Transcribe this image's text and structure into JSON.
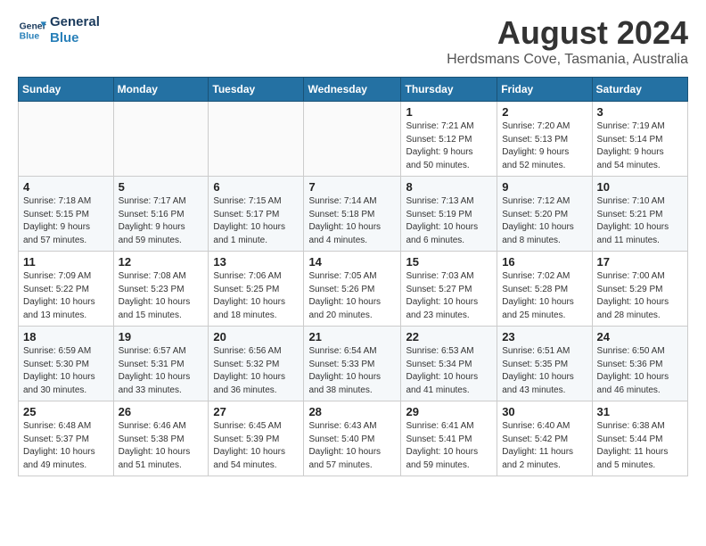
{
  "logo": {
    "line1": "General",
    "line2": "Blue"
  },
  "title": "August 2024",
  "location": "Herdsmans Cove, Tasmania, Australia",
  "headers": [
    "Sunday",
    "Monday",
    "Tuesday",
    "Wednesday",
    "Thursday",
    "Friday",
    "Saturday"
  ],
  "weeks": [
    [
      {
        "day": "",
        "info": ""
      },
      {
        "day": "",
        "info": ""
      },
      {
        "day": "",
        "info": ""
      },
      {
        "day": "",
        "info": ""
      },
      {
        "day": "1",
        "info": "Sunrise: 7:21 AM\nSunset: 5:12 PM\nDaylight: 9 hours\nand 50 minutes."
      },
      {
        "day": "2",
        "info": "Sunrise: 7:20 AM\nSunset: 5:13 PM\nDaylight: 9 hours\nand 52 minutes."
      },
      {
        "day": "3",
        "info": "Sunrise: 7:19 AM\nSunset: 5:14 PM\nDaylight: 9 hours\nand 54 minutes."
      }
    ],
    [
      {
        "day": "4",
        "info": "Sunrise: 7:18 AM\nSunset: 5:15 PM\nDaylight: 9 hours\nand 57 minutes."
      },
      {
        "day": "5",
        "info": "Sunrise: 7:17 AM\nSunset: 5:16 PM\nDaylight: 9 hours\nand 59 minutes."
      },
      {
        "day": "6",
        "info": "Sunrise: 7:15 AM\nSunset: 5:17 PM\nDaylight: 10 hours\nand 1 minute."
      },
      {
        "day": "7",
        "info": "Sunrise: 7:14 AM\nSunset: 5:18 PM\nDaylight: 10 hours\nand 4 minutes."
      },
      {
        "day": "8",
        "info": "Sunrise: 7:13 AM\nSunset: 5:19 PM\nDaylight: 10 hours\nand 6 minutes."
      },
      {
        "day": "9",
        "info": "Sunrise: 7:12 AM\nSunset: 5:20 PM\nDaylight: 10 hours\nand 8 minutes."
      },
      {
        "day": "10",
        "info": "Sunrise: 7:10 AM\nSunset: 5:21 PM\nDaylight: 10 hours\nand 11 minutes."
      }
    ],
    [
      {
        "day": "11",
        "info": "Sunrise: 7:09 AM\nSunset: 5:22 PM\nDaylight: 10 hours\nand 13 minutes."
      },
      {
        "day": "12",
        "info": "Sunrise: 7:08 AM\nSunset: 5:23 PM\nDaylight: 10 hours\nand 15 minutes."
      },
      {
        "day": "13",
        "info": "Sunrise: 7:06 AM\nSunset: 5:25 PM\nDaylight: 10 hours\nand 18 minutes."
      },
      {
        "day": "14",
        "info": "Sunrise: 7:05 AM\nSunset: 5:26 PM\nDaylight: 10 hours\nand 20 minutes."
      },
      {
        "day": "15",
        "info": "Sunrise: 7:03 AM\nSunset: 5:27 PM\nDaylight: 10 hours\nand 23 minutes."
      },
      {
        "day": "16",
        "info": "Sunrise: 7:02 AM\nSunset: 5:28 PM\nDaylight: 10 hours\nand 25 minutes."
      },
      {
        "day": "17",
        "info": "Sunrise: 7:00 AM\nSunset: 5:29 PM\nDaylight: 10 hours\nand 28 minutes."
      }
    ],
    [
      {
        "day": "18",
        "info": "Sunrise: 6:59 AM\nSunset: 5:30 PM\nDaylight: 10 hours\nand 30 minutes."
      },
      {
        "day": "19",
        "info": "Sunrise: 6:57 AM\nSunset: 5:31 PM\nDaylight: 10 hours\nand 33 minutes."
      },
      {
        "day": "20",
        "info": "Sunrise: 6:56 AM\nSunset: 5:32 PM\nDaylight: 10 hours\nand 36 minutes."
      },
      {
        "day": "21",
        "info": "Sunrise: 6:54 AM\nSunset: 5:33 PM\nDaylight: 10 hours\nand 38 minutes."
      },
      {
        "day": "22",
        "info": "Sunrise: 6:53 AM\nSunset: 5:34 PM\nDaylight: 10 hours\nand 41 minutes."
      },
      {
        "day": "23",
        "info": "Sunrise: 6:51 AM\nSunset: 5:35 PM\nDaylight: 10 hours\nand 43 minutes."
      },
      {
        "day": "24",
        "info": "Sunrise: 6:50 AM\nSunset: 5:36 PM\nDaylight: 10 hours\nand 46 minutes."
      }
    ],
    [
      {
        "day": "25",
        "info": "Sunrise: 6:48 AM\nSunset: 5:37 PM\nDaylight: 10 hours\nand 49 minutes."
      },
      {
        "day": "26",
        "info": "Sunrise: 6:46 AM\nSunset: 5:38 PM\nDaylight: 10 hours\nand 51 minutes."
      },
      {
        "day": "27",
        "info": "Sunrise: 6:45 AM\nSunset: 5:39 PM\nDaylight: 10 hours\nand 54 minutes."
      },
      {
        "day": "28",
        "info": "Sunrise: 6:43 AM\nSunset: 5:40 PM\nDaylight: 10 hours\nand 57 minutes."
      },
      {
        "day": "29",
        "info": "Sunrise: 6:41 AM\nSunset: 5:41 PM\nDaylight: 10 hours\nand 59 minutes."
      },
      {
        "day": "30",
        "info": "Sunrise: 6:40 AM\nSunset: 5:42 PM\nDaylight: 11 hours\nand 2 minutes."
      },
      {
        "day": "31",
        "info": "Sunrise: 6:38 AM\nSunset: 5:44 PM\nDaylight: 11 hours\nand 5 minutes."
      }
    ]
  ]
}
